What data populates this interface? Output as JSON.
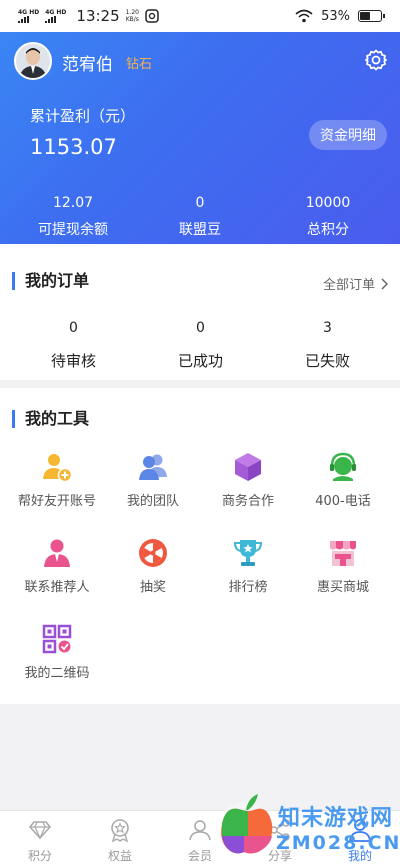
{
  "status_bar": {
    "network_1": "4G HD",
    "network_2": "4G HD",
    "time": "13:25",
    "speed_value": "1.20",
    "speed_unit": "KB/s",
    "battery": "53%",
    "battery_level": 0.53
  },
  "profile": {
    "name": "范宥伯",
    "level": "钻石",
    "cumulative_profit_label": "累计盈利（元）",
    "cumulative_profit_value": "1153.07",
    "detail_button": "资金明细",
    "stats": [
      {
        "value": "12.07",
        "label": "可提现余额"
      },
      {
        "value": "0",
        "label": "联盟豆"
      },
      {
        "value": "10000",
        "label": "总积分"
      }
    ]
  },
  "orders": {
    "title": "我的订单",
    "all_link": "全部订单",
    "items": [
      {
        "value": "0",
        "label": "待审核"
      },
      {
        "value": "0",
        "label": "已成功"
      },
      {
        "value": "3",
        "label": "已失败"
      }
    ]
  },
  "tools": {
    "title": "我的工具",
    "items": [
      {
        "label": "帮好友开账号",
        "icon": "add-user-icon",
        "color": "#f5b731"
      },
      {
        "label": "我的团队",
        "icon": "team-icon",
        "color": "#5b86e5"
      },
      {
        "label": "商务合作",
        "icon": "cube-icon",
        "color": "#a35bd6"
      },
      {
        "label": "400-电话",
        "icon": "headset-icon",
        "color": "#3ab54a"
      },
      {
        "label": "联系推荐人",
        "icon": "person-icon",
        "color": "#e9548e"
      },
      {
        "label": "抽奖",
        "icon": "prize-wheel-icon",
        "color": "#f0573f"
      },
      {
        "label": "排行榜",
        "icon": "trophy-icon",
        "color": "#3fb8d8"
      },
      {
        "label": "惠买商城",
        "icon": "shop-icon",
        "color": "#e9548e"
      },
      {
        "label": "我的二维码",
        "icon": "qr-code-icon",
        "color": "#9b4fd6"
      }
    ]
  },
  "tabbar": {
    "items": [
      {
        "label": "积分",
        "icon": "diamond-icon"
      },
      {
        "label": "权益",
        "icon": "badge-icon"
      },
      {
        "label": "会员",
        "icon": "member-icon"
      },
      {
        "label": "分享",
        "icon": "share-icon"
      },
      {
        "label": "我的",
        "icon": "user-icon",
        "active": true
      }
    ]
  },
  "watermark": {
    "line1": "知末游戏网",
    "line2": "ZM028.CN"
  },
  "colors": {
    "accent": "#3a7bf2",
    "hero_start": "#3a86f4",
    "hero_end": "#4a5cee",
    "level": "#f4b24a"
  }
}
